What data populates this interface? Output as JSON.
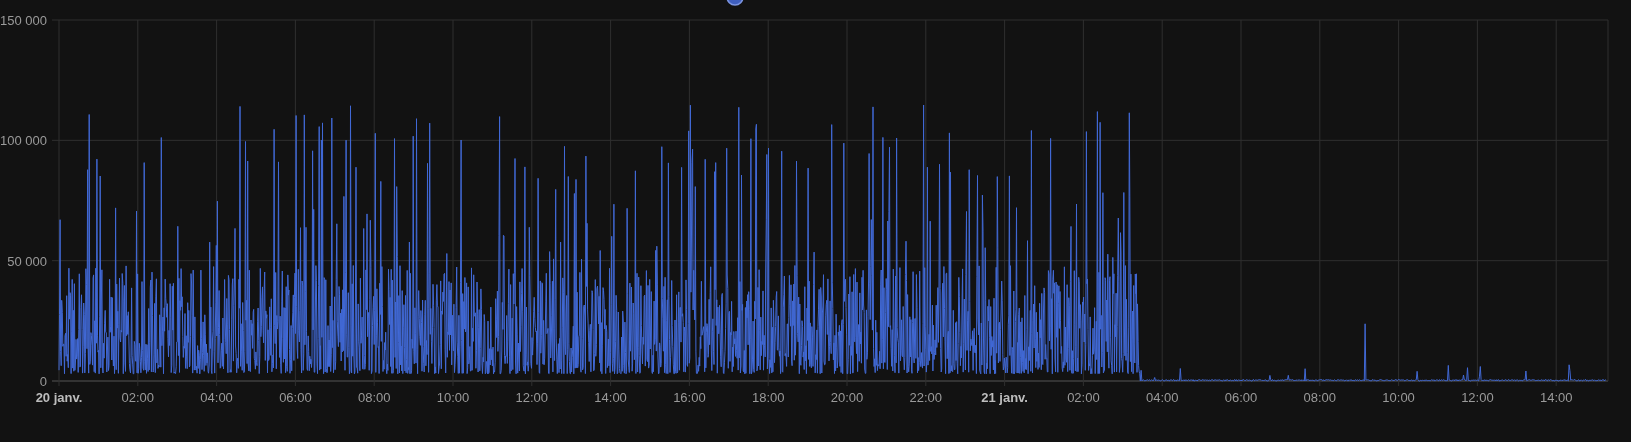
{
  "chart": {
    "y_labels": [
      "150 000",
      "100 000",
      "50 000",
      "0"
    ],
    "x_labels": [
      {
        "text": "20 janv.",
        "kind": "date"
      },
      {
        "text": "02:00",
        "kind": "time"
      },
      {
        "text": "04:00",
        "kind": "time"
      },
      {
        "text": "06:00",
        "kind": "time"
      },
      {
        "text": "08:00",
        "kind": "time"
      },
      {
        "text": "10:00",
        "kind": "time"
      },
      {
        "text": "12:00",
        "kind": "time"
      },
      {
        "text": "14:00",
        "kind": "time"
      },
      {
        "text": "16:00",
        "kind": "time"
      },
      {
        "text": "18:00",
        "kind": "time"
      },
      {
        "text": "20:00",
        "kind": "time"
      },
      {
        "text": "22:00",
        "kind": "time"
      },
      {
        "text": "21 janv.",
        "kind": "date"
      },
      {
        "text": "02:00",
        "kind": "time"
      },
      {
        "text": "04:00",
        "kind": "time"
      },
      {
        "text": "06:00",
        "kind": "time"
      },
      {
        "text": "08:00",
        "kind": "time"
      },
      {
        "text": "10:00",
        "kind": "time"
      },
      {
        "text": "12:00",
        "kind": "time"
      },
      {
        "text": "14:00",
        "kind": "time"
      }
    ]
  }
}
